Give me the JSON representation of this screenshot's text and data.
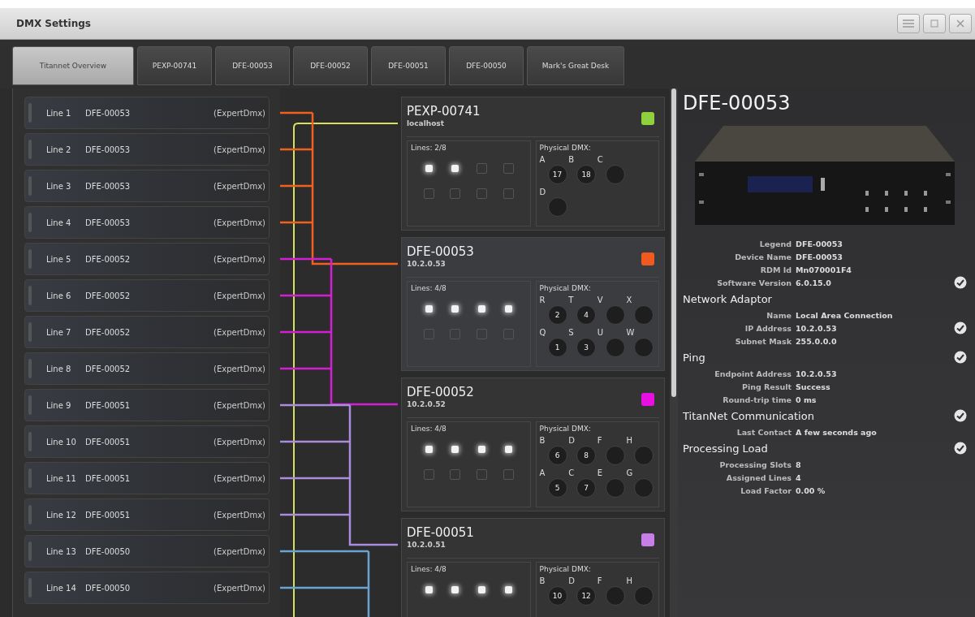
{
  "window": {
    "title": "DMX Settings"
  },
  "tabs": [
    {
      "label": "Titannet Overview",
      "selected": true
    },
    {
      "label": "PEXP-00741",
      "selected": false
    },
    {
      "label": "DFE-00053",
      "selected": false
    },
    {
      "label": "DFE-00052",
      "selected": false
    },
    {
      "label": "DFE-00051",
      "selected": false
    },
    {
      "label": "DFE-00050",
      "selected": false
    },
    {
      "label": "Mark's Great Desk",
      "selected": false
    }
  ],
  "lines": [
    {
      "name": "Line 1",
      "device": "DFE-00053",
      "mode": "(ExpertDmx)",
      "color": "#f0601e"
    },
    {
      "name": "Line 2",
      "device": "DFE-00053",
      "mode": "(ExpertDmx)",
      "color": "#f0601e"
    },
    {
      "name": "Line 3",
      "device": "DFE-00053",
      "mode": "(ExpertDmx)",
      "color": "#f0601e"
    },
    {
      "name": "Line 4",
      "device": "DFE-00053",
      "mode": "(ExpertDmx)",
      "color": "#f0601e"
    },
    {
      "name": "Line 5",
      "device": "DFE-00052",
      "mode": "(ExpertDmx)",
      "color": "#d41ed4"
    },
    {
      "name": "Line 6",
      "device": "DFE-00052",
      "mode": "(ExpertDmx)",
      "color": "#d41ed4"
    },
    {
      "name": "Line 7",
      "device": "DFE-00052",
      "mode": "(ExpertDmx)",
      "color": "#d41ed4"
    },
    {
      "name": "Line 8",
      "device": "DFE-00052",
      "mode": "(ExpertDmx)",
      "color": "#d41ed4"
    },
    {
      "name": "Line 9",
      "device": "DFE-00051",
      "mode": "(ExpertDmx)",
      "color": "#a98cdc"
    },
    {
      "name": "Line 10",
      "device": "DFE-00051",
      "mode": "(ExpertDmx)",
      "color": "#a98cdc"
    },
    {
      "name": "Line 11",
      "device": "DFE-00051",
      "mode": "(ExpertDmx)",
      "color": "#a98cdc"
    },
    {
      "name": "Line 12",
      "device": "DFE-00051",
      "mode": "(ExpertDmx)",
      "color": "#a98cdc"
    },
    {
      "name": "Line 13",
      "device": "DFE-00050",
      "mode": "(ExpertDmx)",
      "color": "#6aa2d2"
    },
    {
      "name": "Line 14",
      "device": "DFE-00050",
      "mode": "(ExpertDmx)",
      "color": "#6aa2d2"
    }
  ],
  "devices": [
    {
      "name": "PEXP-00741",
      "host": "localhost",
      "color": "#8fd03c",
      "lines_label": "Lines: 2/8",
      "leds": [
        {
          "lit": true
        },
        {
          "lit": true
        },
        {
          "lit": false
        },
        {
          "lit": false
        },
        {
          "lit": false
        },
        {
          "lit": false
        },
        {
          "lit": false
        },
        {
          "lit": false
        }
      ],
      "dmx_label": "Physical DMX:",
      "port_rows": [
        [
          {
            "letter": "A",
            "value": "17"
          },
          {
            "letter": "B",
            "value": "18"
          },
          {
            "letter": "C"
          }
        ],
        [
          {
            "letter": "D"
          }
        ]
      ]
    },
    {
      "name": "DFE-00053",
      "host": "10.2.0.53",
      "color": "#f05a1e",
      "lines_label": "Lines: 4/8",
      "leds": [
        {
          "lit": true
        },
        {
          "lit": true
        },
        {
          "lit": true
        },
        {
          "lit": true
        },
        {
          "lit": false
        },
        {
          "lit": false
        },
        {
          "lit": false
        },
        {
          "lit": false
        }
      ],
      "dmx_label": "Physical DMX:",
      "port_rows": [
        [
          {
            "letter": "R",
            "value": "2"
          },
          {
            "letter": "T",
            "value": "4"
          },
          {
            "letter": "V"
          },
          {
            "letter": "X"
          }
        ],
        [
          {
            "letter": "Q",
            "value": "1"
          },
          {
            "letter": "S",
            "value": "3"
          },
          {
            "letter": "U"
          },
          {
            "letter": "W"
          }
        ]
      ]
    },
    {
      "name": "DFE-00052",
      "host": "10.2.0.52",
      "color": "#e810e0",
      "lines_label": "Lines: 4/8",
      "leds": [
        {
          "lit": true
        },
        {
          "lit": true
        },
        {
          "lit": true
        },
        {
          "lit": true
        },
        {
          "lit": false
        },
        {
          "lit": false
        },
        {
          "lit": false
        },
        {
          "lit": false
        }
      ],
      "dmx_label": "Physical DMX:",
      "port_rows": [
        [
          {
            "letter": "B",
            "value": "6"
          },
          {
            "letter": "D",
            "value": "8"
          },
          {
            "letter": "F"
          },
          {
            "letter": "H"
          }
        ],
        [
          {
            "letter": "A",
            "value": "5"
          },
          {
            "letter": "C",
            "value": "7"
          },
          {
            "letter": "E"
          },
          {
            "letter": "G"
          }
        ]
      ]
    },
    {
      "name": "DFE-00051",
      "host": "10.2.0.51",
      "color": "#c87ee8",
      "lines_label": "Lines: 4/8",
      "leds": [
        {
          "lit": true
        },
        {
          "lit": true
        },
        {
          "lit": true
        },
        {
          "lit": true
        }
      ],
      "dmx_label": "Physical DMX:",
      "port_rows": [
        [
          {
            "letter": "B",
            "value": "10"
          },
          {
            "letter": "D",
            "value": "12"
          },
          {
            "letter": "F"
          },
          {
            "letter": "H"
          }
        ]
      ]
    }
  ],
  "detail": {
    "title": "DFE-00053",
    "info": [
      {
        "kind": "field",
        "label": "Legend",
        "value": "DFE-00053",
        "verified": false
      },
      {
        "kind": "field",
        "label": "Device Name",
        "value": "DFE-00053",
        "verified": false
      },
      {
        "kind": "field",
        "label": "RDM Id",
        "value": "Mn070001F4",
        "verified": false
      },
      {
        "kind": "field",
        "label": "Software Version",
        "value": "6.0.15.0",
        "verified": true
      },
      {
        "kind": "heading",
        "label": "Network Adaptor",
        "verified": false
      },
      {
        "kind": "field",
        "label": "Name",
        "value": "Local Area Connection",
        "verified": false
      },
      {
        "kind": "field",
        "label": "IP Address",
        "value": "10.2.0.53",
        "verified": true
      },
      {
        "kind": "field",
        "label": "Subnet Mask",
        "value": "255.0.0.0",
        "verified": false
      },
      {
        "kind": "heading",
        "label": "Ping",
        "verified": true
      },
      {
        "kind": "field",
        "label": "Endpoint Address",
        "value": "10.2.0.53",
        "verified": false
      },
      {
        "kind": "field",
        "label": "Ping Result",
        "value": "Success",
        "verified": false
      },
      {
        "kind": "field",
        "label": "Round-trip time",
        "value": "0 ms",
        "verified": false
      },
      {
        "kind": "heading",
        "label": "TitanNet Communication",
        "verified": true
      },
      {
        "kind": "field",
        "label": "Last Contact",
        "value": "A few seconds ago",
        "verified": false
      },
      {
        "kind": "heading",
        "label": "Processing Load",
        "verified": true
      },
      {
        "kind": "field",
        "label": "Processing Slots",
        "value": "8",
        "verified": false
      },
      {
        "kind": "field",
        "label": "Assigned Lines",
        "value": "4",
        "verified": false
      },
      {
        "kind": "field",
        "label": "Load Factor",
        "value": "0.00 %",
        "verified": false
      }
    ]
  }
}
